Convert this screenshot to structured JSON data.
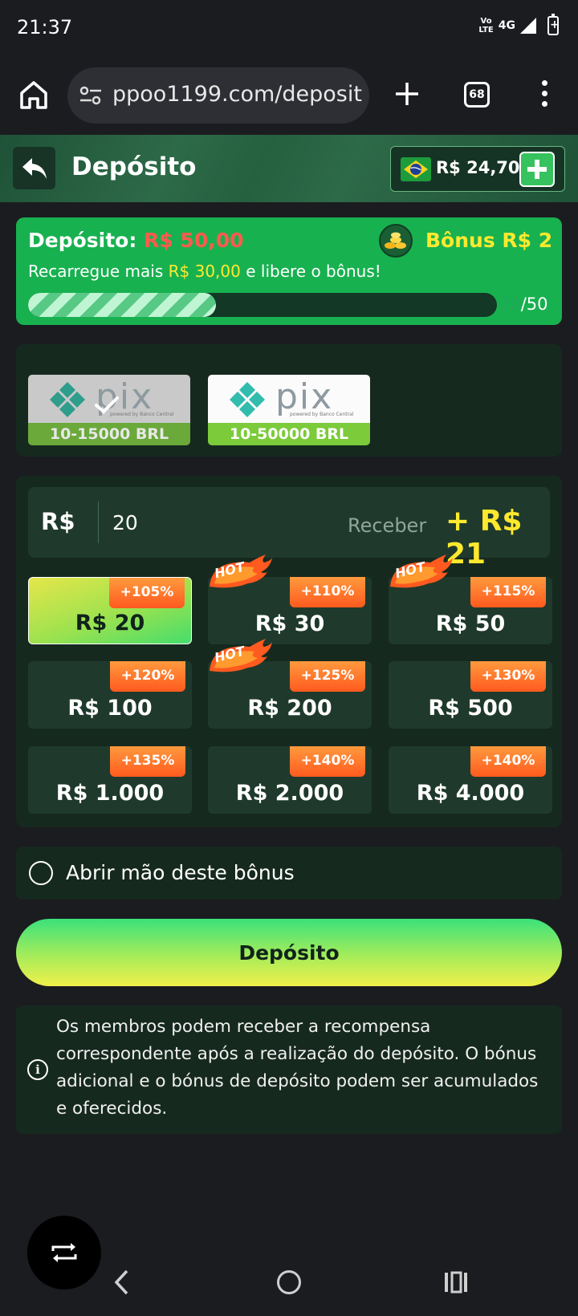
{
  "status": {
    "time": "21:37",
    "volte_top": "Vo",
    "volte_bottom": "LTE",
    "network": "4G"
  },
  "browser": {
    "url": "ppoo1199.com/deposit",
    "tab_count": "68"
  },
  "header": {
    "title": "Depósito",
    "balance": "R$ 24,70"
  },
  "promo": {
    "deposit_label": "Depósito:",
    "deposit_amount": "R$ 50,00",
    "bonus_label": "Bônus R$ 2",
    "sub_prefix": "Recarregue mais",
    "sub_amount": "R$ 30,00",
    "sub_suffix": "e libere o bônus!",
    "progress_current": "20",
    "progress_total": "/50",
    "progress_fraction": 0.4
  },
  "methods": [
    {
      "word": "pix",
      "caption": "powered by Banco Central",
      "range": "10-15000 BRL",
      "selected": true
    },
    {
      "word": "pix",
      "caption": "powered by Banco Central",
      "range": "10-50000 BRL",
      "selected": false
    }
  ],
  "amount": {
    "currency": "R$",
    "value": "20",
    "receive_label": "Receber",
    "receive_value": "+ R$ 21"
  },
  "hot_label": "HOT",
  "tiles": [
    {
      "amount": "R$ 20",
      "bonus": "+105%"
    },
    {
      "amount": "R$ 30",
      "bonus": "+110%"
    },
    {
      "amount": "R$ 50",
      "bonus": "+115%"
    },
    {
      "amount": "R$ 100",
      "bonus": "+120%"
    },
    {
      "amount": "R$ 200",
      "bonus": "+125%"
    },
    {
      "amount": "R$ 500",
      "bonus": "+130%"
    },
    {
      "amount": "R$ 1.000",
      "bonus": "+135%"
    },
    {
      "amount": "R$ 2.000",
      "bonus": "+140%"
    },
    {
      "amount": "R$ 4.000",
      "bonus": "+140%"
    }
  ],
  "renounce_label": "Abrir mão deste bônus",
  "deposit_button": "Depósito",
  "info_text": "Os membros podem receber a recompensa correspondente após a realização do depósito. O bónus adicional e o bónus de depósito podem ser acumulados e oferecidos.",
  "colors": {
    "accent_green": "#18b150",
    "highlight_yellow": "#ffe92e",
    "panel": "#16291f",
    "hot_orange": "#ff5a1f"
  }
}
